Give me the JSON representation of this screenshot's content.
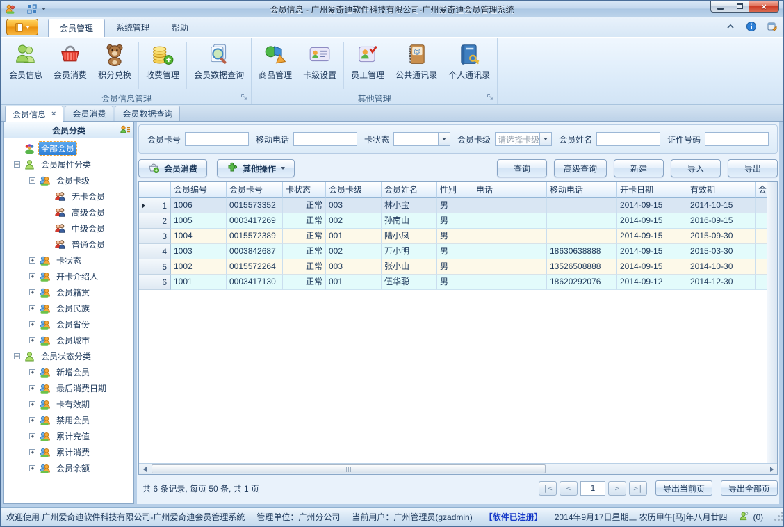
{
  "colors": {
    "accent_orange": "#f5a623",
    "selection_blue": "#2d7fd6",
    "link_blue": "#1538c8",
    "row_cyan": "#e3fbfb",
    "row_cream": "#fdf9e9",
    "close_red": "#cc3a24"
  },
  "window": {
    "title": "会员信息 - 广州爱奇迪软件科技有限公司-广州爱奇迪会员管理系统"
  },
  "ribbon": {
    "tabs": [
      {
        "label": "会员管理",
        "active": true
      },
      {
        "label": "系统管理",
        "active": false
      },
      {
        "label": "帮助",
        "active": false
      }
    ],
    "groups": [
      {
        "label": "会员信息管理",
        "items": [
          {
            "label": "会员信息",
            "icon": "members-icon"
          },
          {
            "label": "会员消费",
            "icon": "consume-basket-icon"
          },
          {
            "label": "积分兑换",
            "icon": "points-teddy-icon",
            "sep_after": true
          },
          {
            "label": "收费管理",
            "icon": "fees-coins-icon",
            "sep_after": true
          },
          {
            "label": "会员数据查询",
            "icon": "data-query-icon"
          }
        ]
      },
      {
        "label": "其他管理",
        "items": [
          {
            "label": "商品管理",
            "icon": "goods-icon"
          },
          {
            "label": "卡级设置",
            "icon": "card-level-icon",
            "sep_after": true
          },
          {
            "label": "员工管理",
            "icon": "staff-icon"
          },
          {
            "label": "公共通讯录",
            "icon": "public-contacts-icon"
          },
          {
            "label": "个人通讯录",
            "icon": "personal-contacts-icon"
          }
        ]
      }
    ]
  },
  "doc_tabs": [
    {
      "label": "会员信息",
      "active": true,
      "closable": true
    },
    {
      "label": "会员消费",
      "active": false
    },
    {
      "label": "会员数据查询",
      "active": false
    }
  ],
  "sidebar": {
    "title": "会员分类",
    "items": [
      {
        "label": "全部会员",
        "depth": 0,
        "icon": "group-icon",
        "selected": true
      },
      {
        "label": "会员属性分类",
        "depth": 0,
        "icon": "person-green-icon",
        "expander": "minus"
      },
      {
        "label": "会员卡级",
        "depth": 1,
        "icon": "people-orange-icon",
        "expander": "minus"
      },
      {
        "label": "无卡会员",
        "depth": 2,
        "icon": "couple-icon"
      },
      {
        "label": "高级会员",
        "depth": 2,
        "icon": "couple-icon"
      },
      {
        "label": "中级会员",
        "depth": 2,
        "icon": "couple-icon"
      },
      {
        "label": "普通会员",
        "depth": 2,
        "icon": "couple-icon"
      },
      {
        "label": "卡状态",
        "depth": 1,
        "icon": "people-orange-icon",
        "expander": "plus"
      },
      {
        "label": "开卡介绍人",
        "depth": 1,
        "icon": "people-orange-icon",
        "expander": "plus"
      },
      {
        "label": "会员籍贯",
        "depth": 1,
        "icon": "people-orange-icon",
        "expander": "plus"
      },
      {
        "label": "会员民族",
        "depth": 1,
        "icon": "people-orange-icon",
        "expander": "plus"
      },
      {
        "label": "会员省份",
        "depth": 1,
        "icon": "people-orange-icon",
        "expander": "plus"
      },
      {
        "label": "会员城市",
        "depth": 1,
        "icon": "people-orange-icon",
        "expander": "plus"
      },
      {
        "label": "会员状态分类",
        "depth": 0,
        "icon": "person-green-icon",
        "expander": "minus"
      },
      {
        "label": "新增会员",
        "depth": 1,
        "icon": "people-orange-icon",
        "expander": "plus"
      },
      {
        "label": "最后消费日期",
        "depth": 1,
        "icon": "people-orange-icon",
        "expander": "plus"
      },
      {
        "label": "卡有效期",
        "depth": 1,
        "icon": "people-orange-icon",
        "expander": "plus"
      },
      {
        "label": "禁用会员",
        "depth": 1,
        "icon": "people-orange-icon",
        "expander": "plus"
      },
      {
        "label": "累计充值",
        "depth": 1,
        "icon": "people-orange-icon",
        "expander": "plus"
      },
      {
        "label": "累计消费",
        "depth": 1,
        "icon": "people-orange-icon",
        "expander": "plus"
      },
      {
        "label": "会员余额",
        "depth": 1,
        "icon": "people-orange-icon",
        "expander": "plus"
      }
    ]
  },
  "filters": [
    {
      "label": "会员卡号",
      "type": "text",
      "value": ""
    },
    {
      "label": "移动电话",
      "type": "text",
      "value": ""
    },
    {
      "label": "卡状态",
      "type": "select",
      "value": "",
      "is_placeholder": false
    },
    {
      "label": "会员卡级",
      "type": "select",
      "value": "请选择卡级",
      "is_placeholder": true
    },
    {
      "label": "会员姓名",
      "type": "text",
      "value": ""
    },
    {
      "label": "证件号码",
      "type": "text",
      "value": ""
    }
  ],
  "toolbar": {
    "left": [
      {
        "label": "会员消费",
        "icon": "basket-plus-icon",
        "dropdown": false
      },
      {
        "label": "其他操作",
        "icon": "puzzle-icon",
        "dropdown": true
      }
    ],
    "right": [
      {
        "label": "查询"
      },
      {
        "label": "高级查询"
      },
      {
        "label": "新建"
      },
      {
        "label": "导入"
      },
      {
        "label": "导出"
      }
    ]
  },
  "grid": {
    "columns": [
      "会员编号",
      "会员卡号",
      "卡状态",
      "会员卡级",
      "会员姓名",
      "性别",
      "电话",
      "移动电话",
      "开卡日期",
      "有效期",
      "会员"
    ],
    "rows": [
      {
        "num": 1,
        "selected": true,
        "cells": [
          "1006",
          "0015573352",
          "正常",
          "003",
          "林小宝",
          "男",
          "",
          "",
          "2014-09-15",
          "2014-10-15",
          ""
        ]
      },
      {
        "num": 2,
        "cells": [
          "1005",
          "0003417269",
          "正常",
          "002",
          "孙南山",
          "男",
          "",
          "",
          "2014-09-15",
          "2016-09-15",
          ""
        ]
      },
      {
        "num": 3,
        "cells": [
          "1004",
          "0015572389",
          "正常",
          "001",
          "陆小凤",
          "男",
          "",
          "",
          "2014-09-15",
          "2015-09-30",
          ""
        ]
      },
      {
        "num": 4,
        "cells": [
          "1003",
          "0003842687",
          "正常",
          "002",
          "万小明",
          "男",
          "",
          "18630638888",
          "2014-09-15",
          "2015-03-30",
          ""
        ]
      },
      {
        "num": 5,
        "cells": [
          "1002",
          "0015572264",
          "正常",
          "003",
          "张小山",
          "男",
          "",
          "13526508888",
          "2014-09-15",
          "2014-10-30",
          ""
        ]
      },
      {
        "num": 6,
        "cells": [
          "1001",
          "0003417130",
          "正常",
          "001",
          "伍华聪",
          "男",
          "",
          "18620292076",
          "2014-09-12",
          "2014-12-30",
          ""
        ]
      }
    ]
  },
  "pager": {
    "summary": "共 6 条记录, 每页 50 条, 共 1 页",
    "first": "|<",
    "prev": "<",
    "page": "1",
    "next": ">",
    "last": ">|",
    "export_current": "导出当前页",
    "export_all": "导出全部页"
  },
  "status_bar": {
    "welcome": "欢迎使用 广州爱奇迪软件科技有限公司-广州爱奇迪会员管理系统",
    "unit": "管理单位：广州分公司",
    "user": "当前用户：广州管理员(gzadmin)",
    "registered": "【软件已注册】",
    "date": "2014年9月17日星期三 农历甲午[马]年八月廿四",
    "online": "(0)"
  }
}
